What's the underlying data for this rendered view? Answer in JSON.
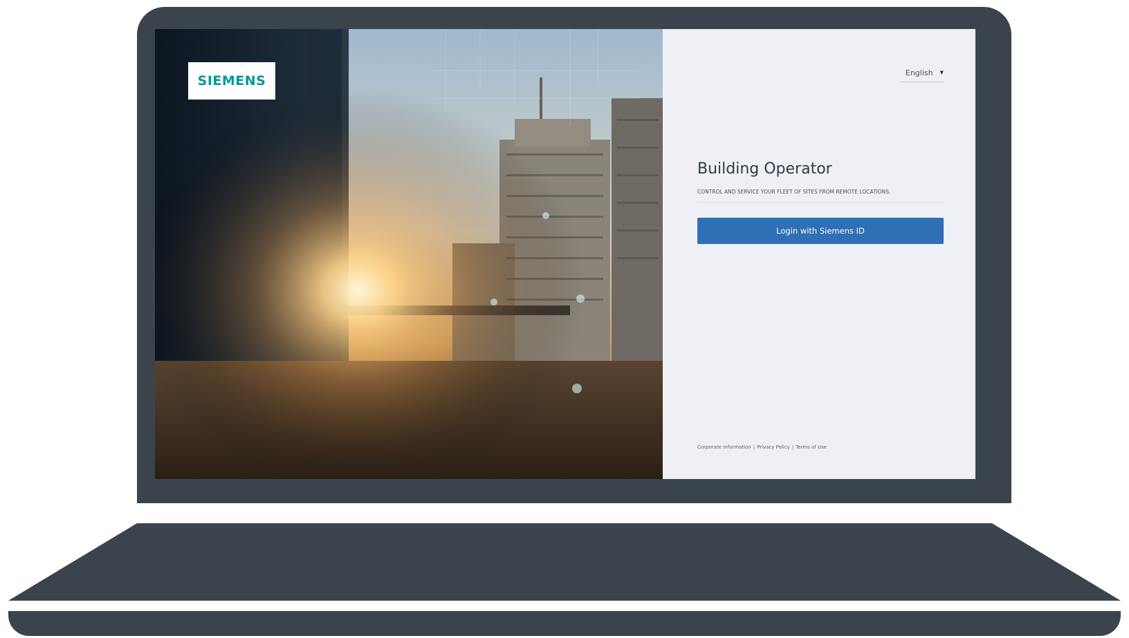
{
  "colors": {
    "device_frame": "#3b444c",
    "panel_background": "#eff0f5",
    "brand": "#009999",
    "primary_button": "#2f6fb5"
  },
  "hero": {
    "logo": "SIEMENS",
    "image": "city-buildings-sunset-photo"
  },
  "language": {
    "selected": "English",
    "caret_icon": "caret-down-icon"
  },
  "app": {
    "title": "Building Operator",
    "subtitle": "CONTROL AND SERVICE YOUR FLEET OF SITES FROM REMOTE LOCATIONS."
  },
  "login": {
    "button_label": "Login with Siemens ID"
  },
  "footer": {
    "links": [
      "Corporate Information",
      "Privacy Policy",
      "Terms of Use"
    ],
    "separator": "|"
  }
}
